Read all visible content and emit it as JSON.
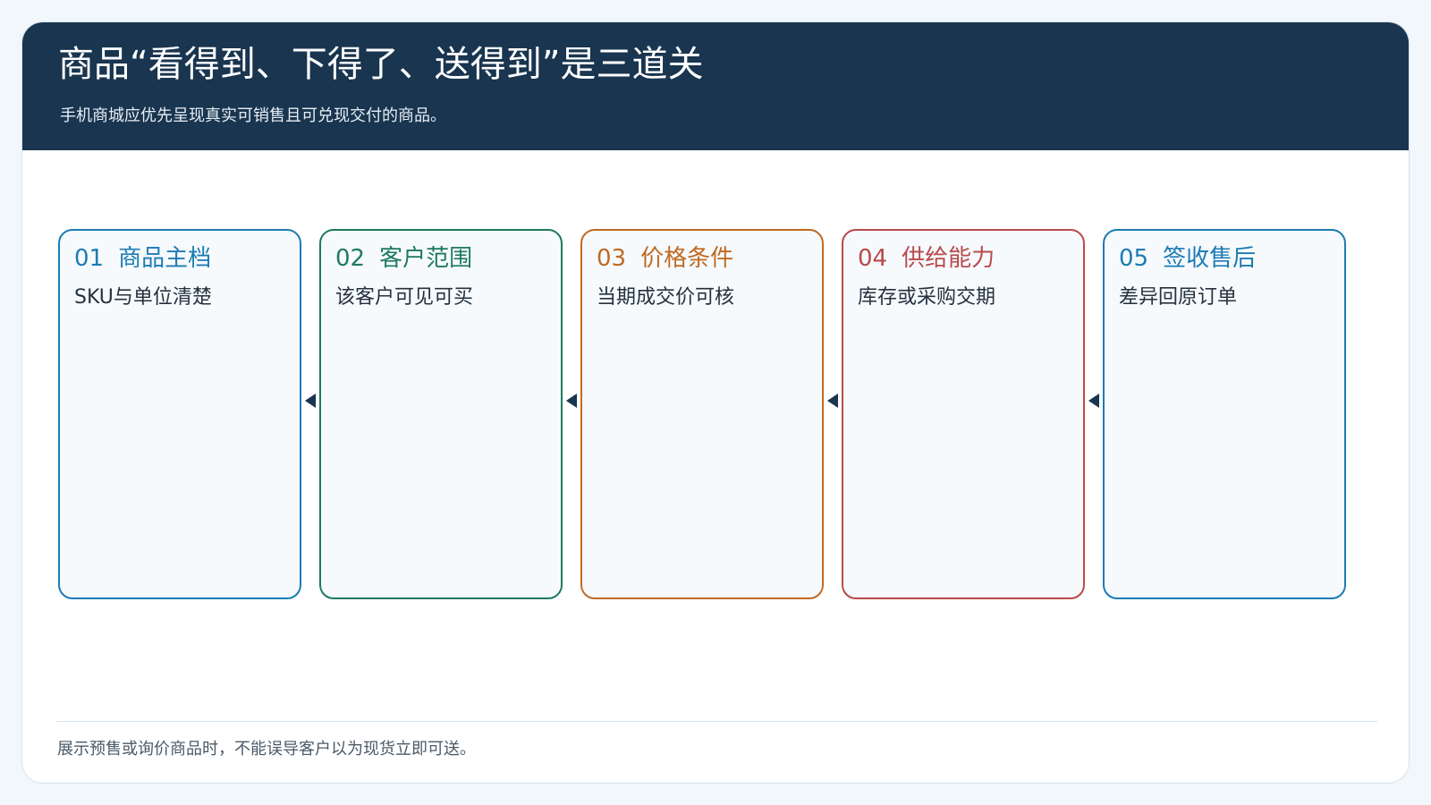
{
  "header": {
    "title": "商品“看得到、下得了、送得到”是三道关",
    "subtitle": "手机商城应优先呈现真实可销售且可兑现交付的商品。"
  },
  "steps": [
    {
      "number": "01",
      "title": "商品主档",
      "description": "SKU与单位清楚",
      "color": "#1c7bb3"
    },
    {
      "number": "02",
      "title": "客户范围",
      "description": "该客户可见可买",
      "color": "#1f7a5d"
    },
    {
      "number": "03",
      "title": "价格条件",
      "description": "当期成交价可核",
      "color": "#c06a22"
    },
    {
      "number": "04",
      "title": "供给能力",
      "description": "库存或采购交期",
      "color": "#b94a4a"
    },
    {
      "number": "05",
      "title": "签收售后",
      "description": "差异回原订单",
      "color": "#1c7bb3"
    }
  ],
  "footer": {
    "note": "展示预售或询价商品时，不能误导客户以为现货立即可送。"
  }
}
